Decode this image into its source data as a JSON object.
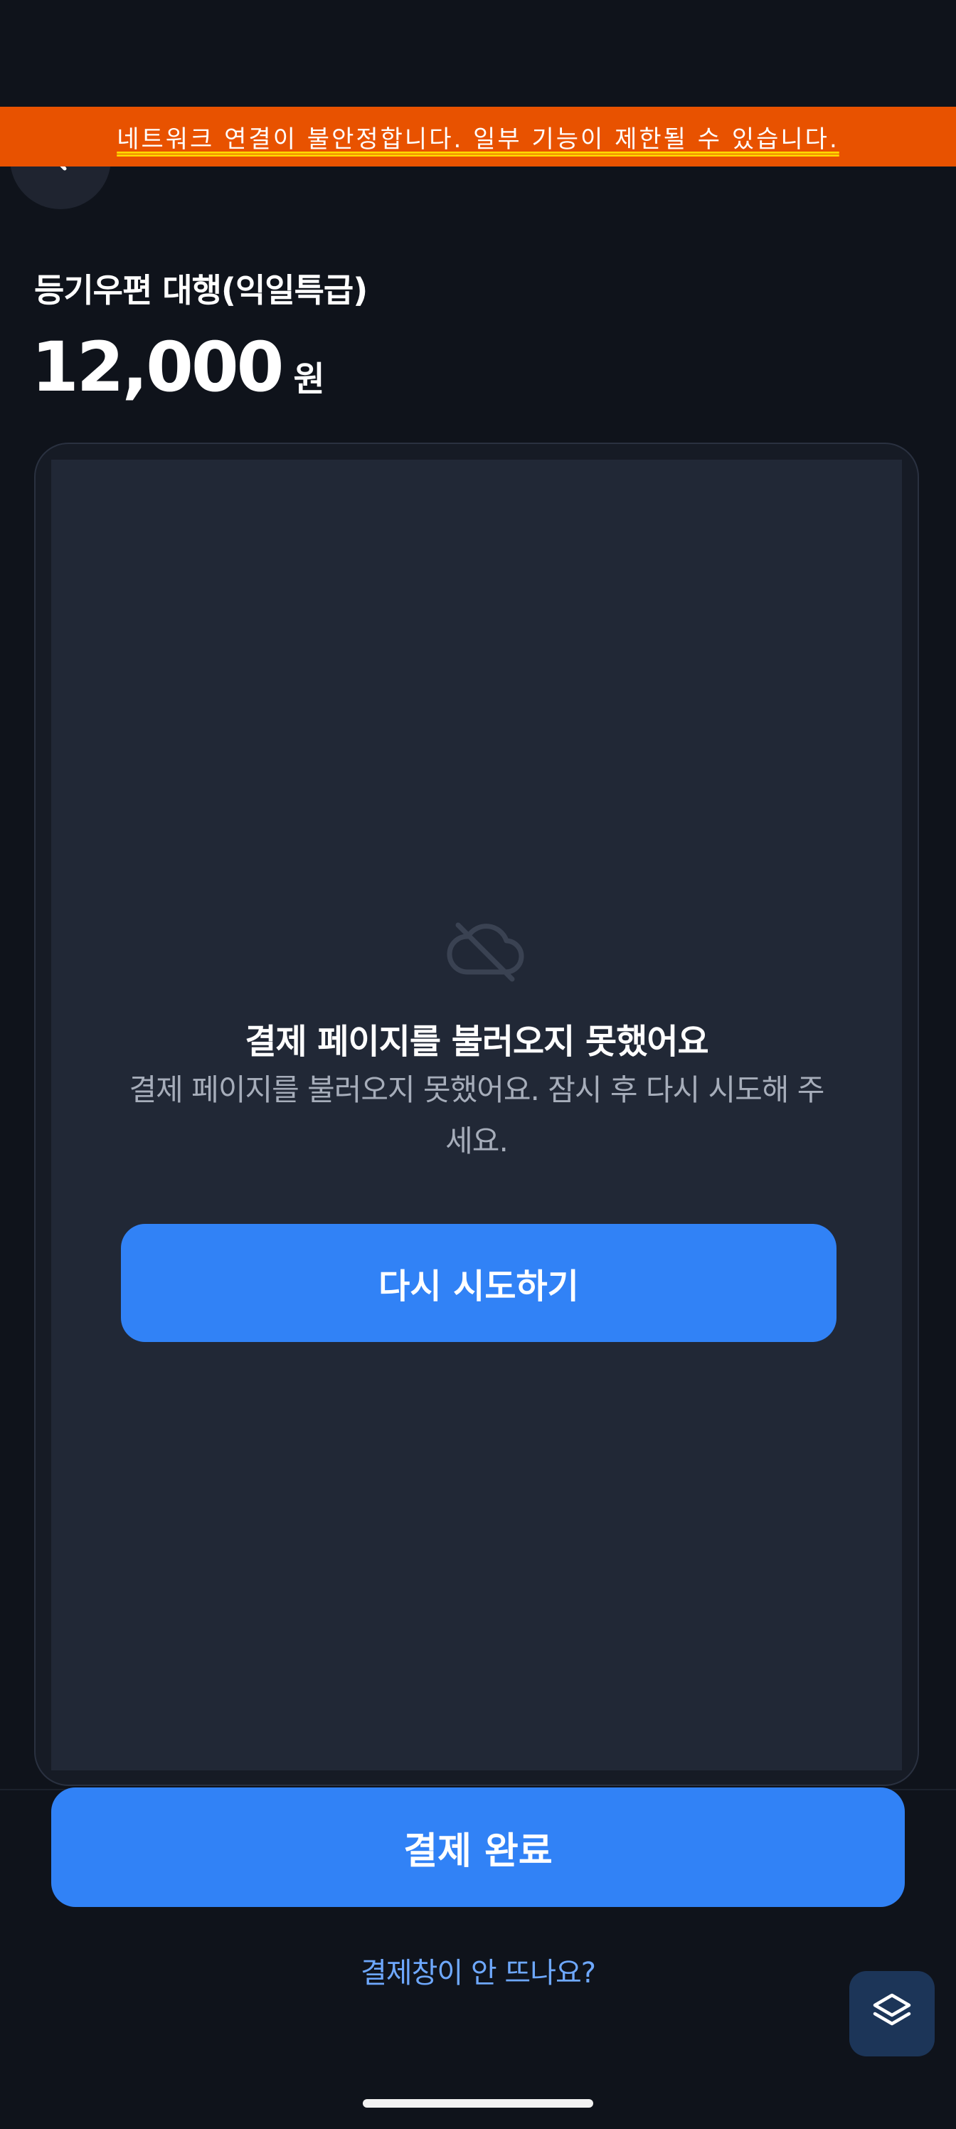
{
  "banner": {
    "text": "네트워크 연결이 불안정합니다. 일부 기능이 제한될 수 있습니다.",
    "color": "#e85200"
  },
  "header": {
    "back_icon": "chevron-left-icon"
  },
  "product": {
    "title": "등기우편 대행(익일특급)",
    "price": "12,000",
    "currency": "원"
  },
  "payment_frame": {
    "error_icon": "cloud-off-icon",
    "error_title": "결제 페이지를 불러오지 못했어요",
    "error_message": "결제 페이지를 불러오지 못했어요. 잠시 후 다시 시도해 주세요.",
    "retry_label": "다시 시도하기"
  },
  "footer": {
    "complete_label": "결제 완료",
    "help_link": "결제창이 안 뜨나요?",
    "floating_icon": "layers-icon"
  },
  "colors": {
    "background": "#0f131b",
    "primary": "#3182f6",
    "link": "#6ea8fe"
  }
}
